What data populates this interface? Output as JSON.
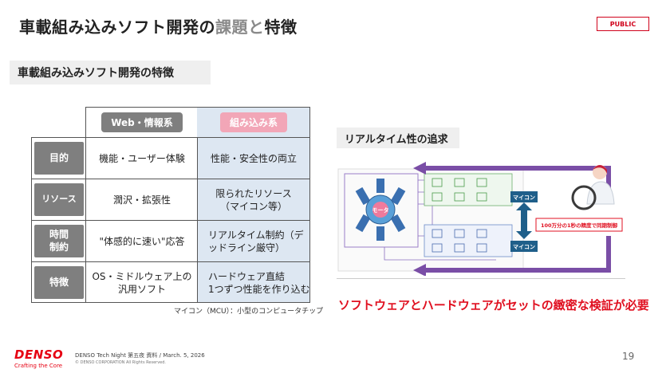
{
  "title": {
    "part1": "車載組み込みソフト開発の",
    "part2": "課題",
    "part3": "と",
    "part4": "特徴"
  },
  "badge": "PUBLIC",
  "section_heading": "車載組み込みソフト開発の特徴",
  "table": {
    "col_web": "Web・情報系",
    "col_embedded": "組み込み系",
    "rows": [
      {
        "label": "目的",
        "web": "機能・ユーザー体験",
        "embedded": "性能・安全性の両立"
      },
      {
        "label": "リソース",
        "web": "潤沢・拡張性",
        "embedded": "限られたリソース\n（マイコン等）"
      },
      {
        "label": "時間\n制約",
        "web": "\"体感的に速い\"応答",
        "embedded": "リアルタイム制約（デ\nッドライン厳守）"
      },
      {
        "label": "特徴",
        "web": "OS・ミドルウェア上の\n汎用ソフト",
        "embedded": "ハードウェア直結\n1つずつ性能を作り込む"
      }
    ]
  },
  "footnote": "マイコン（MCU）：小型のコンピュータチップ",
  "realtime_label": "リアルタイム性の追求",
  "diagram": {
    "motor": "モータ",
    "mcu_top": "マイコン",
    "mcu_bottom": "マイコン",
    "sync_note": "100万分の1秒の精度で同期制御"
  },
  "callout": "ソフトウェアとハードウェアがセットの緻密な検証が必要",
  "footer": {
    "brand": "DENSO",
    "tagline": "Crafting the Core",
    "event": "DENSO Tech Night 第五夜 資料 / March. 5, 2026",
    "copyright": "© DENSO CORPORATION All Rights Reserved."
  },
  "page_number": "19",
  "colors": {
    "accent_red": "#e01020",
    "arrow_purple": "#7a4ea6",
    "embedded_pink": "#f2a6b7",
    "embedded_bg": "#dde7f2"
  }
}
